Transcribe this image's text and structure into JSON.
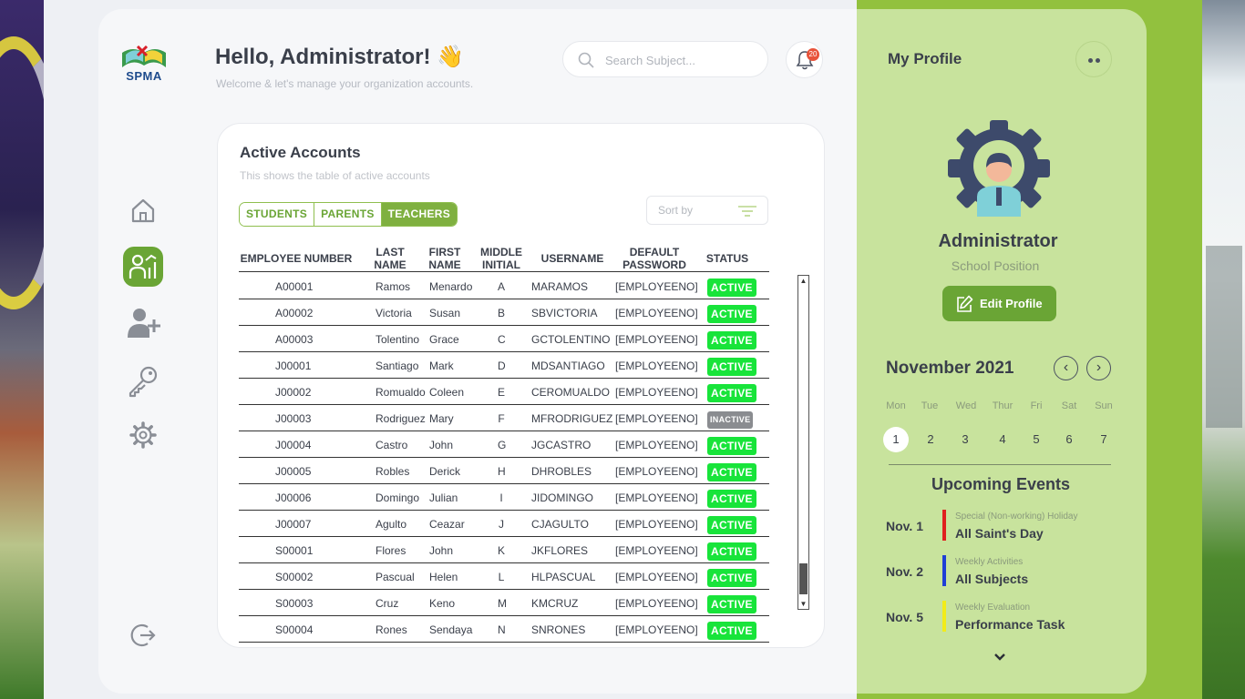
{
  "header": {
    "greeting": "Hello, Administrator! 👋",
    "subtitle": "Welcome & let's manage your organization accounts.",
    "search_placeholder": "Search Subject...",
    "notification_count": "20"
  },
  "logo": {
    "text": "SPMA"
  },
  "nav": [
    {
      "icon": "home-icon"
    },
    {
      "icon": "dashboard-user-icon",
      "active": true
    },
    {
      "icon": "add-user-icon"
    },
    {
      "icon": "key-icon"
    },
    {
      "icon": "gear-icon"
    },
    {
      "icon": "logout-icon"
    }
  ],
  "accounts": {
    "title": "Active Accounts",
    "subtitle": "This shows the table of active accounts",
    "tabs": [
      "STUDENTS",
      "PARENTS",
      "TEACHERS"
    ],
    "active_tab": "TEACHERS",
    "sort_label": "Sort by",
    "columns": [
      "EMPLOYEE NUMBER",
      "LAST NAME",
      "FIRST NAME",
      "MIDDLE INITIAL",
      "USERNAME",
      "DEFAULT PASSWORD",
      "STATUS"
    ],
    "rows": [
      [
        "A00001",
        "Ramos",
        "Menardo",
        "A",
        "MARAMOS",
        "[EMPLOYEENO]",
        "ACTIVE"
      ],
      [
        "A00002",
        "Victoria",
        "Susan",
        "B",
        "SBVICTORIA",
        "[EMPLOYEENO]",
        "ACTIVE"
      ],
      [
        "A00003",
        "Tolentino",
        "Grace",
        "C",
        "GCTOLENTINO",
        "[EMPLOYEENO]",
        "ACTIVE"
      ],
      [
        "J00001",
        "Santiago",
        "Mark",
        "D",
        "MDSANTIAGO",
        "[EMPLOYEENO]",
        "ACTIVE"
      ],
      [
        "J00002",
        "Romualdo",
        "Coleen",
        "E",
        "CEROMUALDO",
        "[EMPLOYEENO]",
        "ACTIVE"
      ],
      [
        "J00003",
        "Rodriguez",
        "Mary",
        "F",
        "MFRODRIGUEZ",
        "[EMPLOYEENO]",
        "INACTIVE"
      ],
      [
        "J00004",
        "Castro",
        "John",
        "G",
        "JGCASTRO",
        "[EMPLOYEENO]",
        "ACTIVE"
      ],
      [
        "J00005",
        "Robles",
        "Derick",
        "H",
        "DHROBLES",
        "[EMPLOYEENO]",
        "ACTIVE"
      ],
      [
        "J00006",
        "Domingo",
        "Julian",
        "I",
        "JIDOMINGO",
        "[EMPLOYEENO]",
        "ACTIVE"
      ],
      [
        "J00007",
        "Agulto",
        "Ceazar",
        "J",
        "CJAGULTO",
        "[EMPLOYEENO]",
        "ACTIVE"
      ],
      [
        "S00001",
        "Flores",
        "John",
        "K",
        "JKFLORES",
        "[EMPLOYEENO]",
        "ACTIVE"
      ],
      [
        "S00002",
        "Pascual",
        "Helen",
        "L",
        "HLPASCUAL",
        "[EMPLOYEENO]",
        "ACTIVE"
      ],
      [
        "S00003",
        "Cruz",
        "Keno",
        "M",
        "KMCRUZ",
        "[EMPLOYEENO]",
        "ACTIVE"
      ],
      [
        "S00004",
        "Rones",
        "Sendaya",
        "N",
        "SNRONES",
        "[EMPLOYEENO]",
        "ACTIVE"
      ]
    ]
  },
  "profile": {
    "title": "My Profile",
    "name": "Administrator",
    "position": "School Position",
    "edit_label": "Edit Profile"
  },
  "calendar": {
    "month": "November 2021",
    "days": [
      "Mon",
      "Tue",
      "Wed",
      "Thur",
      "Fri",
      "Sat",
      "Sun"
    ],
    "dates": [
      "1",
      "2",
      "3",
      "4",
      "5",
      "6",
      "7"
    ],
    "today": "1"
  },
  "events": {
    "title": "Upcoming Events",
    "items": [
      {
        "date": "Nov. 1",
        "category": "Special (Non-working) Holiday",
        "name": "All Saint's Day",
        "color": "#e0201e"
      },
      {
        "date": "Nov. 2",
        "category": "Weekly Activities",
        "name": "All Subjects",
        "color": "#1f3fd6"
      },
      {
        "date": "Nov. 5",
        "category": "Weekly Evaluation",
        "name": "Performance Task",
        "color": "#f2ec1a"
      }
    ]
  },
  "colors": {
    "accent": "#6aa535",
    "active": "#18e43a",
    "inactive": "#8a8c90"
  }
}
